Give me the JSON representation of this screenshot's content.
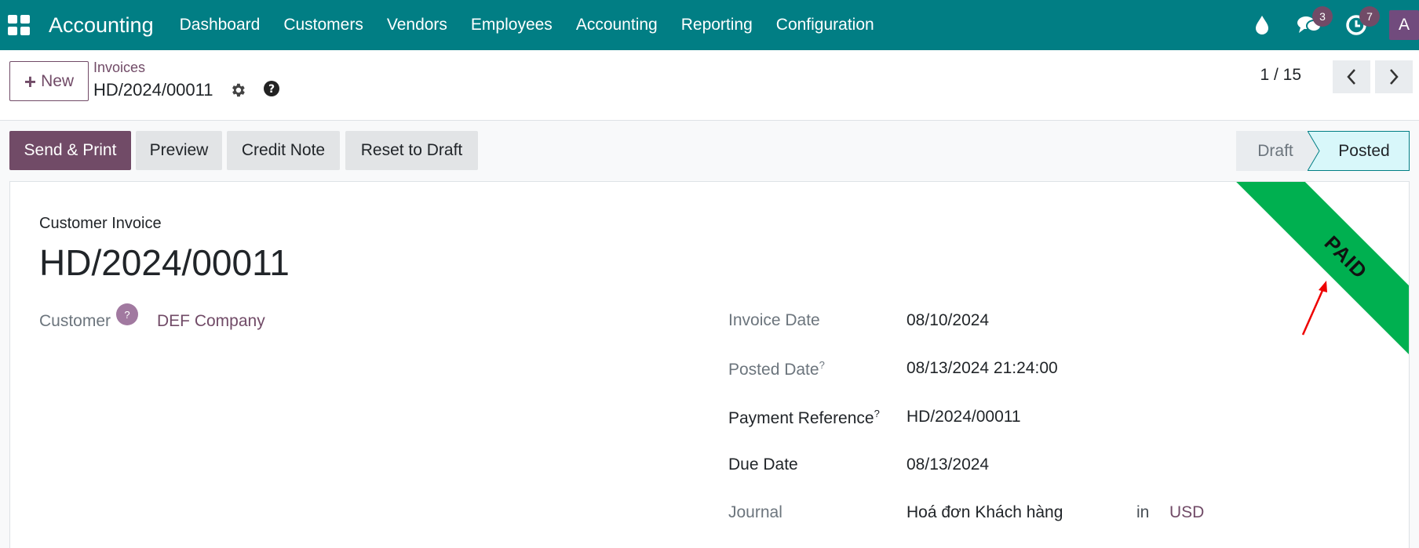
{
  "navbar": {
    "app_name": "Accounting",
    "menu": [
      "Dashboard",
      "Customers",
      "Vendors",
      "Employees",
      "Accounting",
      "Reporting",
      "Configuration"
    ],
    "messages_count": "3",
    "activities_count": "7",
    "avatar_initial": "A"
  },
  "control": {
    "new_label": "New",
    "breadcrumb": "Invoices",
    "record_name": "HD/2024/00011",
    "pager": "1 / 15"
  },
  "actions": {
    "send_print": "Send & Print",
    "preview": "Preview",
    "credit_note": "Credit Note",
    "reset_to_draft": "Reset to Draft"
  },
  "status": {
    "draft": "Draft",
    "posted": "Posted",
    "active": "Posted"
  },
  "form": {
    "doc_type": "Customer Invoice",
    "title": "HD/2024/00011",
    "ribbon": "PAID",
    "ribbon_color": "#00b050",
    "customer_label": "Customer",
    "customer_help": "?",
    "customer_value": "DEF Company",
    "invoice_date_label": "Invoice Date",
    "invoice_date_value": "08/10/2024",
    "posted_date_label": "Posted Date",
    "posted_date_help": "?",
    "posted_date_value": "08/13/2024 21:24:00",
    "payment_ref_label": "Payment Reference",
    "payment_ref_help": "?",
    "payment_ref_value": "HD/2024/00011",
    "due_date_label": "Due Date",
    "due_date_value": "08/13/2024",
    "journal_label": "Journal",
    "journal_value": "Hoá đơn Khách hàng",
    "journal_in": "in",
    "currency": "USD"
  },
  "colors": {
    "navbar": "#017e84",
    "primary": "#714b67"
  }
}
